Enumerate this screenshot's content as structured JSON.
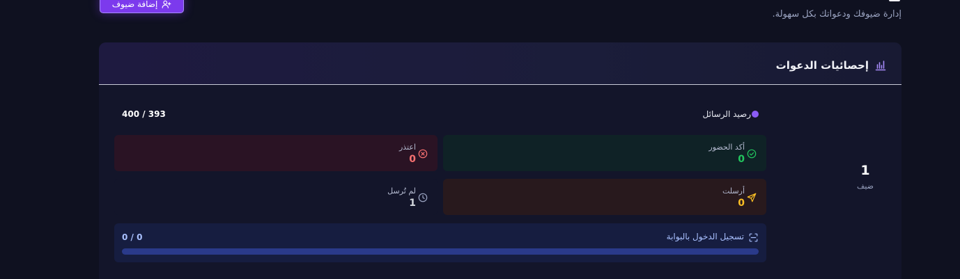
{
  "header": {
    "add_guests_label": "إضافة ضيوف",
    "subtitle": "إدارة ضيوفك ودعواتك بكل سهولة."
  },
  "stats_card": {
    "title": "إحصائيات الدعوات",
    "guests": {
      "count": "1",
      "label": "ضيف"
    },
    "message_balance": {
      "label": "رصيد الرسائل",
      "value": "400 / 393"
    },
    "confirmed": {
      "label": "أكد الحضور",
      "value": "0",
      "color": "#22c55e"
    },
    "declined": {
      "label": "اعتذر",
      "value": "0",
      "color": "#f87171"
    },
    "sent": {
      "label": "أرسلت",
      "value": "0",
      "color": "#fbbf24"
    },
    "unsent": {
      "label": "لم تُرسل",
      "value": "1",
      "color": "#d1d5db"
    },
    "gate_checkin": {
      "label": "تسجيل الدخول بالبوابة",
      "value": "0 / 0",
      "progress": 0
    }
  },
  "icons": {
    "add_guests": "user-plus-icon",
    "stats": "bar-chart-icon",
    "confirmed": "check-circle-icon",
    "declined": "x-circle-icon",
    "sent": "send-icon",
    "unsent": "clock-icon",
    "gate": "scan-icon"
  },
  "colors": {
    "accent": "#7c3aed",
    "balance_dot": "#8b5cf6"
  }
}
